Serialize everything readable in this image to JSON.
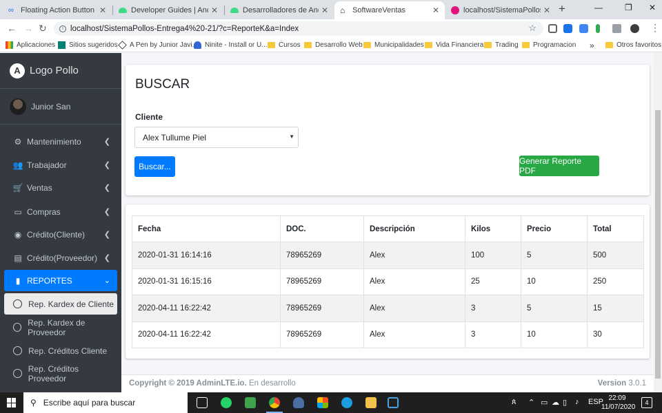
{
  "browser": {
    "tabs": [
      {
        "label": "Floating Action Button - Unive",
        "icon": "link-icon",
        "active": false
      },
      {
        "label": "Developer Guides  |  Android D",
        "icon": "android-icon",
        "active": false
      },
      {
        "label": "Desarrolladores de Android  |",
        "icon": "android-icon",
        "active": false
      },
      {
        "label": "SoftwareVentas",
        "icon": "home-icon",
        "active": true
      },
      {
        "label": "localhost/SistemaPollos-Entreg",
        "icon": "github-icon",
        "active": false
      }
    ],
    "url": "localhost/SistemaPollos-Entrega4%20-21/?c=ReporteK&a=Index",
    "bookmarks": [
      {
        "label": "Aplicaciones",
        "icon": "apps-icon"
      },
      {
        "label": "Sitios sugeridos",
        "icon": "bing-icon"
      },
      {
        "label": "A Pen by Junior Javi...",
        "icon": "codepen-icon"
      },
      {
        "label": "Ninite - Install or U...",
        "icon": "ninite-icon"
      },
      {
        "label": "Cursos",
        "icon": "folder-icon"
      },
      {
        "label": "Desarrollo Web",
        "icon": "folder-icon"
      },
      {
        "label": "Municipalidades",
        "icon": "folder-icon"
      },
      {
        "label": "Vida Financiera",
        "icon": "folder-icon"
      },
      {
        "label": "Trading",
        "icon": "folder-icon"
      },
      {
        "label": "Programacion",
        "icon": "folder-icon"
      },
      {
        "label": "Otros favoritos",
        "icon": "folder-icon"
      }
    ],
    "more_bookmarks": "»"
  },
  "sidebar": {
    "brand": "Logo Pollo",
    "brand_initial": "A",
    "user": "Junior San",
    "items": [
      {
        "label": "Mantenimiento",
        "icon": "gears-icon"
      },
      {
        "label": "Trabajador",
        "icon": "users-icon"
      },
      {
        "label": "Ventas",
        "icon": "cart-icon"
      },
      {
        "label": "Compras",
        "icon": "wallet-icon"
      },
      {
        "label": "Crédito(Cliente)",
        "icon": "user-coin-icon"
      },
      {
        "label": "Crédito(Proveedor)",
        "icon": "money-icon"
      },
      {
        "label": "REPORTES",
        "icon": "file-icon"
      }
    ],
    "subitems": [
      {
        "label": "Rep. Kardex de Cliente"
      },
      {
        "label": "Rep. Kardex de Proveedor"
      },
      {
        "label": "Rep. Créditos Cliente"
      },
      {
        "label": "Rep. Créditos Proveedor"
      }
    ]
  },
  "search": {
    "title": "BUSCAR",
    "client_label": "Cliente",
    "client_value": "Alex Tullume Piel",
    "search_button": "Buscar...",
    "pdf_button": "Generar Reporte PDF"
  },
  "table": {
    "headers": [
      "Fecha",
      "DOC.",
      "Descripción",
      "Kilos",
      "Precio",
      "Total"
    ],
    "rows": [
      [
        "2020-01-31 16:14:16",
        "78965269",
        "Alex",
        "100",
        "5",
        "500"
      ],
      [
        "2020-01-31 16:15:16",
        "78965269",
        "Alex",
        "25",
        "10",
        "250"
      ],
      [
        "2020-04-11 16:22:42",
        "78965269",
        "Alex",
        "3",
        "5",
        "15"
      ],
      [
        "2020-04-11 16:22:42",
        "78965269",
        "Alex",
        "3",
        "10",
        "30"
      ]
    ]
  },
  "footer": {
    "copyright": "Copyright © 2019 AdminLTE.io.",
    "status": "En desarrollo",
    "version_label": "Version",
    "version": "3.0.1"
  },
  "taskbar": {
    "search_placeholder": "Escribe aquí para buscar",
    "language": "ESP",
    "time": "22:09",
    "date": "11/07/2020",
    "notifications": "4"
  },
  "colors": {
    "primary": "#007bff",
    "success": "#28a745",
    "sidebar": "#343a40"
  }
}
